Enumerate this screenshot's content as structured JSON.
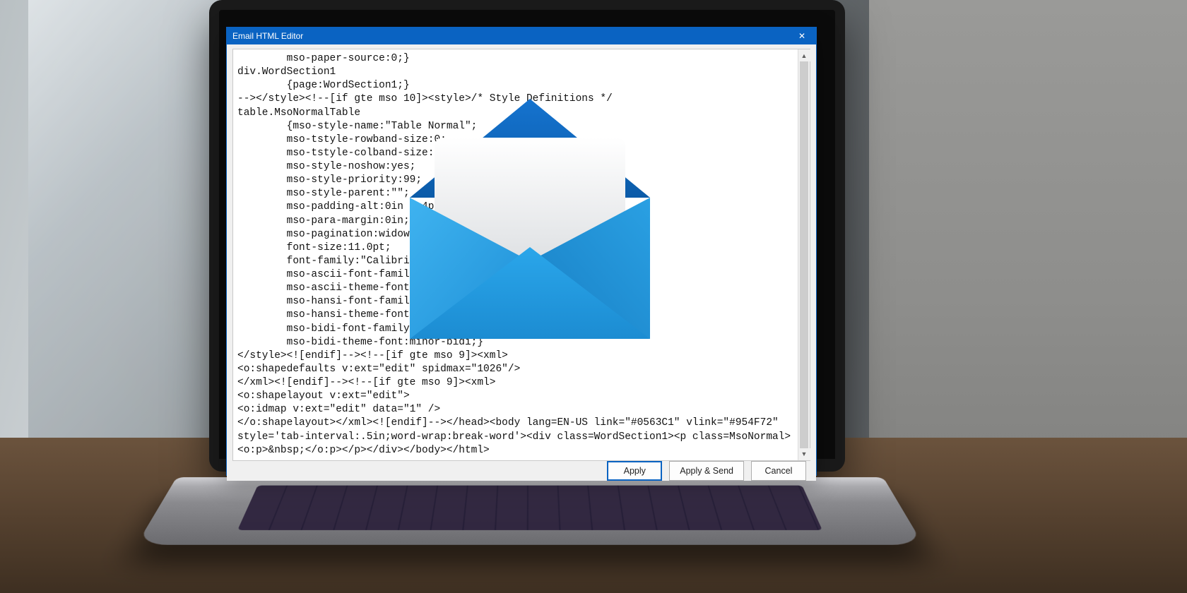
{
  "window": {
    "title": "Email HTML Editor",
    "close_glyph": "✕"
  },
  "editor": {
    "content": "        mso-paper-source:0;}\ndiv.WordSection1\n        {page:WordSection1;}\n--></style><!--[if gte mso 10]><style>/* Style Definitions */\ntable.MsoNormalTable\n        {mso-style-name:\"Table Normal\";\n        mso-tstyle-rowband-size:0;\n        mso-tstyle-colband-size:0;\n        mso-style-noshow:yes;\n        mso-style-priority:99;\n        mso-style-parent:\"\";\n        mso-padding-alt:0in 5.4pt 0in 5.4pt;\n        mso-para-margin:0in;\n        mso-pagination:widow-orphan;\n        font-size:11.0pt;\n        font-family:\"Calibri\",sans-serif;\n        mso-ascii-font-family:Calibri;\n        mso-ascii-theme-font:minor-latin;\n        mso-hansi-font-family:Calibri;\n        mso-hansi-theme-font:minor-latin;\n        mso-bidi-font-family:\"Times New Roman\";\n        mso-bidi-theme-font:minor-bidi;}\n</style><![endif]--><!--[if gte mso 9]><xml>\n<o:shapedefaults v:ext=\"edit\" spidmax=\"1026\"/>\n</xml><![endif]--><!--[if gte mso 9]><xml>\n<o:shapelayout v:ext=\"edit\">\n<o:idmap v:ext=\"edit\" data=\"1\" />\n</o:shapelayout></xml><![endif]--></head><body lang=EN-US link=\"#0563C1\" vlink=\"#954F72\" style='tab-interval:.5in;word-wrap:break-word'><div class=WordSection1><p class=MsoNormal><o:p>&nbsp;</o:p></p></div></body></html>"
  },
  "buttons": {
    "apply": "Apply",
    "apply_send": "Apply & Send",
    "cancel": "Cancel"
  },
  "scroll": {
    "up_glyph": "▲",
    "down_glyph": "▼"
  },
  "icon": {
    "name": "mail-envelope-icon",
    "colors": {
      "back_dark": "#0b5ba8",
      "back_light": "#1573cf",
      "paper": "#eef0f2",
      "flap_left": "#27a3e8",
      "flap_right": "#1e8fd6",
      "bottom": "#2299e3"
    }
  }
}
